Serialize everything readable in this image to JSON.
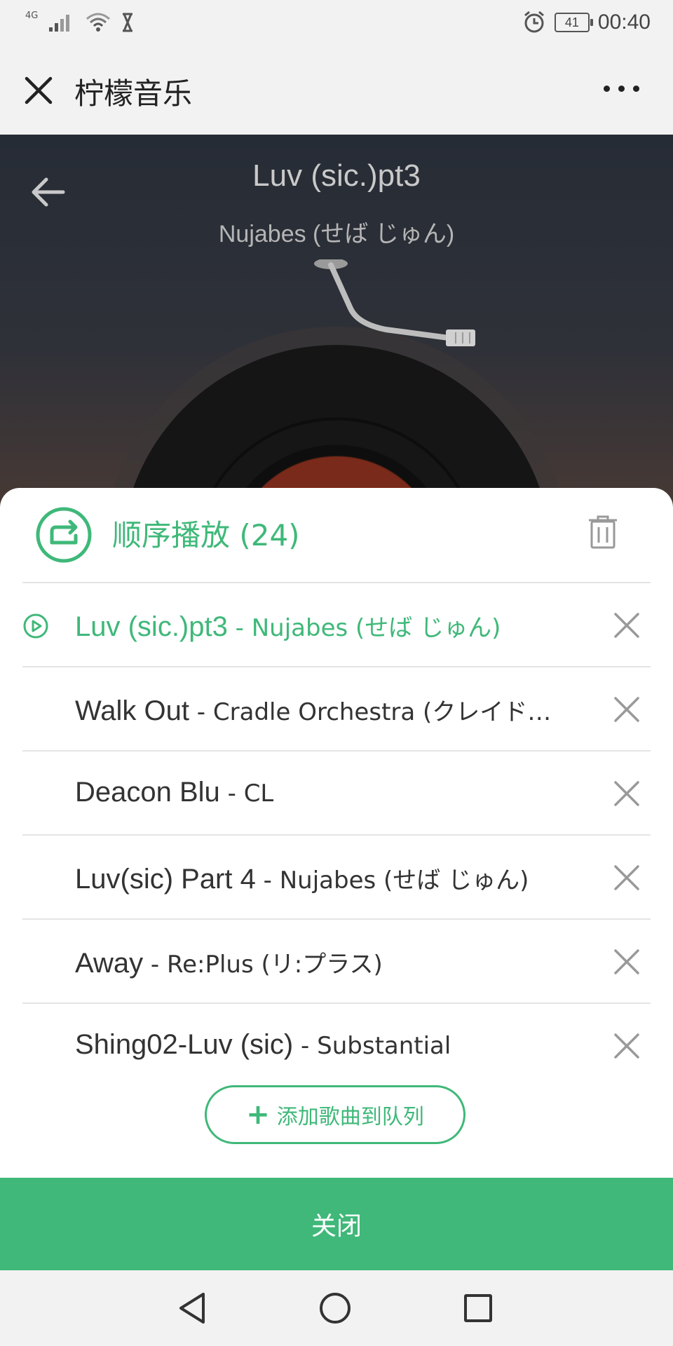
{
  "status_bar": {
    "network": "4G",
    "battery": "41",
    "time": "00:40",
    "icons": [
      "signal-icon",
      "wifi-icon",
      "hourglass-icon",
      "alarm-icon",
      "battery-icon"
    ]
  },
  "app_bar": {
    "title": "柠檬音乐",
    "icons": [
      "close-icon",
      "more-icon"
    ]
  },
  "player": {
    "title": "Luv (sic.)pt3",
    "artist": "Nujabes (せば じゅん)",
    "icons": [
      "back-arrow-icon",
      "tonearm-icon"
    ]
  },
  "queue": {
    "mode_label": "顺序播放 (24)",
    "accent_color": "#3fb879",
    "items": [
      {
        "song": "Luv (sic.)pt3",
        "sep": " - ",
        "artist": "Nujabes (せば じゅん)",
        "active": true
      },
      {
        "song": "Walk Out",
        "sep": " - ",
        "artist": "Cradle Orchestra (クレイド…",
        "active": false
      },
      {
        "song": "Deacon Blu",
        "sep": " - ",
        "artist": "CL",
        "active": false
      },
      {
        "song": "Luv(sic) Part 4",
        "sep": " - ",
        "artist": "Nujabes (せば じゅん)",
        "active": false
      },
      {
        "song": "Away",
        "sep": " - ",
        "artist": "Re:Plus (リ:プラス)",
        "active": false
      },
      {
        "song": "Shing02-Luv (sic)",
        "sep": " - ",
        "artist": "Substantial",
        "active": false
      }
    ],
    "add_label": "添加歌曲到队列",
    "close_label": "关闭"
  },
  "nav_bar": {
    "icons": [
      "nav-back-icon",
      "nav-home-icon",
      "nav-recent-icon"
    ]
  }
}
